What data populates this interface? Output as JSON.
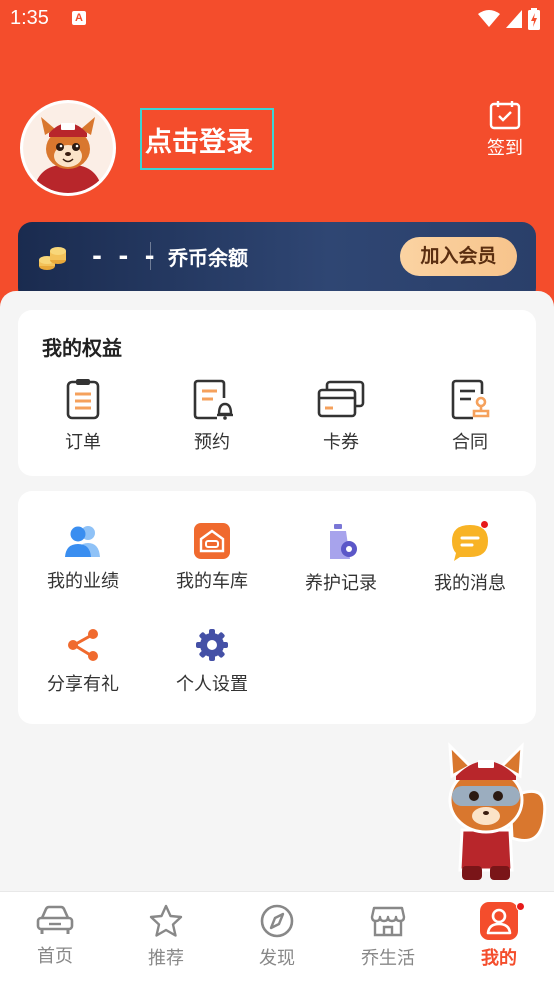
{
  "status_bar": {
    "time": "1:35",
    "notif_icon_text": "A"
  },
  "header": {
    "login_text": "点击登录",
    "checkin_label": "签到",
    "brand_color": "#f44d2c"
  },
  "vip_bar": {
    "coin_value": "- - -",
    "balance_label": "乔币余额",
    "join_button": "加入会员"
  },
  "benefits": {
    "title": "我的权益",
    "items": [
      {
        "label": "订单",
        "icon": "clipboard-icon"
      },
      {
        "label": "预约",
        "icon": "appointment-icon"
      },
      {
        "label": "卡券",
        "icon": "cards-icon"
      },
      {
        "label": "合同",
        "icon": "contract-icon"
      }
    ]
  },
  "services": {
    "items": [
      {
        "label": "我的业绩",
        "icon": "users-icon"
      },
      {
        "label": "我的车库",
        "icon": "garage-icon"
      },
      {
        "label": "养护记录",
        "icon": "maintenance-icon"
      },
      {
        "label": "我的消息",
        "icon": "message-icon"
      },
      {
        "label": "分享有礼",
        "icon": "share-icon"
      },
      {
        "label": "个人设置",
        "icon": "gear-icon"
      }
    ]
  },
  "tabbar": {
    "tabs": [
      {
        "label": "首页",
        "icon": "car-icon"
      },
      {
        "label": "推荐",
        "icon": "star-icon"
      },
      {
        "label": "发现",
        "icon": "compass-icon"
      },
      {
        "label": "乔生活",
        "icon": "store-icon"
      },
      {
        "label": "我的",
        "icon": "profile-icon",
        "active": true
      }
    ]
  }
}
